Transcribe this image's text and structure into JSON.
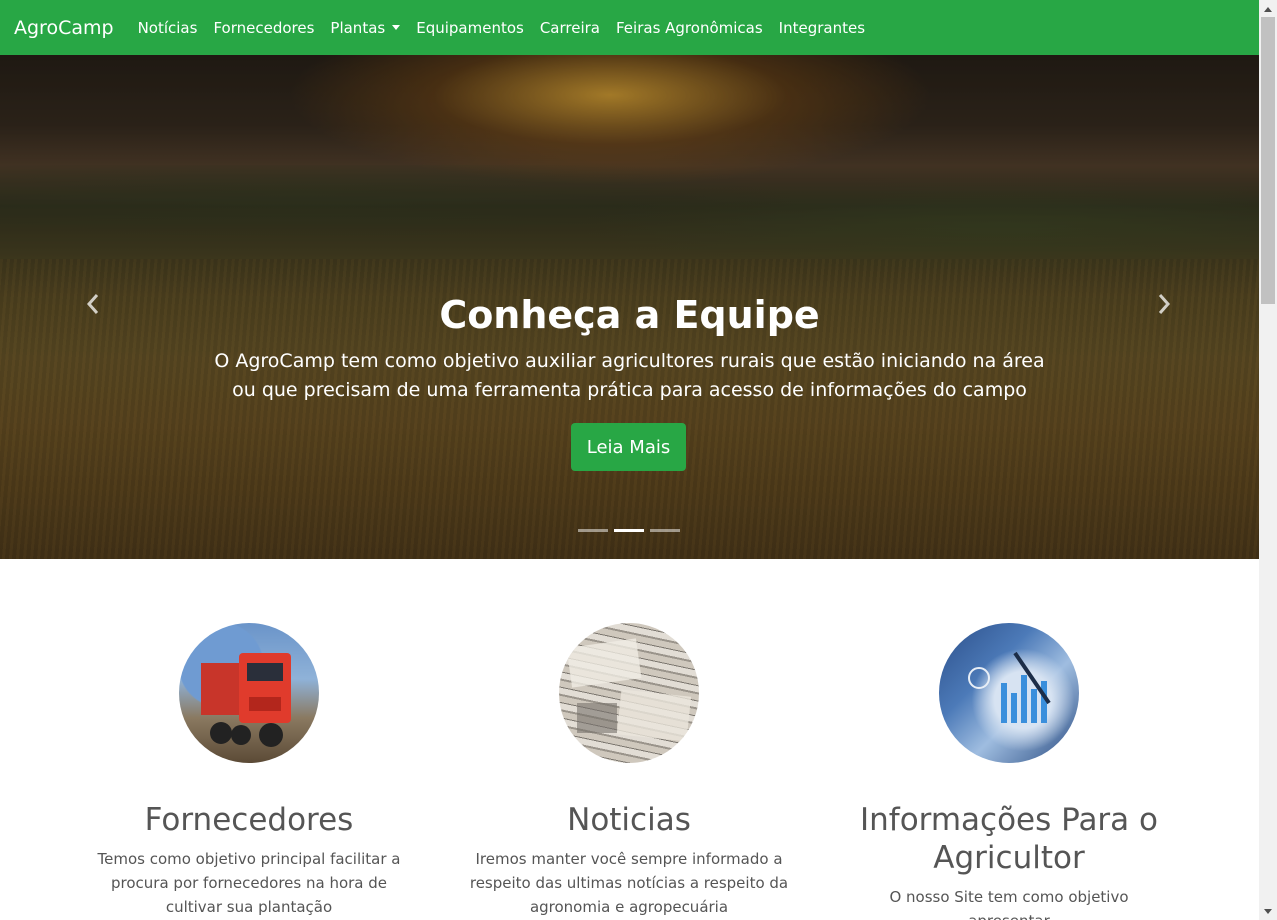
{
  "navbar": {
    "brand": "AgroCamp",
    "items": [
      {
        "label": "Notícias"
      },
      {
        "label": "Fornecedores"
      },
      {
        "label": "Plantas",
        "dropdown": true
      },
      {
        "label": "Equipamentos"
      },
      {
        "label": "Carreira"
      },
      {
        "label": "Feiras Agronômicas"
      },
      {
        "label": "Integrantes"
      }
    ],
    "color": "#28a745"
  },
  "carousel": {
    "title": "Conheça a Equipe",
    "text": "O AgroCamp tem como objetivo auxiliar agricultores rurais que estão iniciando na área ou que precisam de uma ferramenta prática para acesso de informações do campo",
    "button_label": "Leia Mais",
    "prev_icon": "chevron-left-icon",
    "next_icon": "chevron-right-icon",
    "slide_count": 3,
    "active_slide": 2
  },
  "features": [
    {
      "image": "red-truck-image",
      "title": "Fornecedores",
      "text": "Temos como objetivo principal facilitar a procura por fornecedores na hora de cultivar sua plantação"
    },
    {
      "image": "newspapers-image",
      "title": "Noticias",
      "text": "Iremos manter você sempre informado a respeito das ultimas notícias a respeito da agronomia e agropecuária"
    },
    {
      "image": "charts-data-image",
      "title": "Informações Para o Agricultor",
      "text": "O nosso Site tem como objetivo apresentar"
    }
  ],
  "colors": {
    "accent": "#28a745",
    "text": "#555555"
  }
}
